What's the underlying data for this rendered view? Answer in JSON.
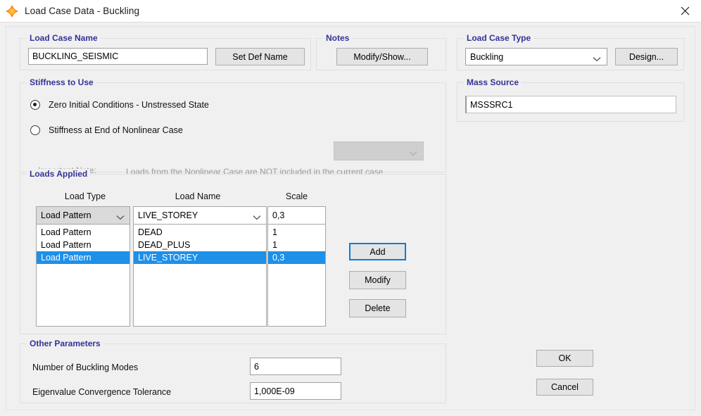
{
  "window": {
    "title": "Load Case Data - Buckling",
    "icon": "app-star-icon",
    "close_label": "×"
  },
  "load_case_name": {
    "legend": "Load Case Name",
    "value": "BUCKLING_SEISMIC",
    "set_def_name_button": "Set Def Name"
  },
  "notes": {
    "legend": "Notes",
    "modify_show_button": "Modify/Show..."
  },
  "load_case_type": {
    "legend": "Load Case Type",
    "selected": "Buckling",
    "options": [
      "Buckling"
    ],
    "design_button": "Design..."
  },
  "stiffness_to_use": {
    "legend": "Stiffness to Use",
    "option_zero_initial": "Zero Initial Conditions - Unstressed State",
    "option_nonlinear": "Stiffness at End of Nonlinear Case",
    "selected_option": "zero_initial",
    "nonlinear_case_value": "",
    "nonlinear_case_enabled": false,
    "important_note_label": "Important Note:",
    "important_note_text": "Loads from the Nonlinear Case are NOT included in the current case"
  },
  "mass_source": {
    "legend": "Mass Source",
    "value": "MSSSRC1"
  },
  "loads_applied": {
    "legend": "Loads Applied",
    "columns": [
      "Load Type",
      "Load Name",
      "Scale"
    ],
    "edit_row": {
      "load_type": "Load Pattern",
      "load_name": "LIVE_STOREY",
      "scale": "0,3"
    },
    "rows": [
      {
        "load_type": "Load Pattern",
        "load_name": "DEAD",
        "scale": "1",
        "selected": false
      },
      {
        "load_type": "Load Pattern",
        "load_name": "DEAD_PLUS",
        "scale": "1",
        "selected": false
      },
      {
        "load_type": "Load Pattern",
        "load_name": "LIVE_STOREY",
        "scale": "0,3",
        "selected": true
      }
    ],
    "buttons": {
      "add": "Add",
      "modify": "Modify",
      "delete": "Delete"
    }
  },
  "other_parameters": {
    "legend": "Other Parameters",
    "number_of_buckling_modes_label": "Number of Buckling Modes",
    "number_of_buckling_modes_value": "6",
    "eigenvalue_tolerance_label": "Eigenvalue Convergence Tolerance",
    "eigenvalue_tolerance_value": "1,000E-09"
  },
  "dialog_buttons": {
    "ok": "OK",
    "cancel": "Cancel"
  },
  "colors": {
    "group_legend": "#333399",
    "selection": "#1e90e8",
    "focus_border": "#0a7cd8",
    "dialog_bg": "#f0f0f0"
  }
}
